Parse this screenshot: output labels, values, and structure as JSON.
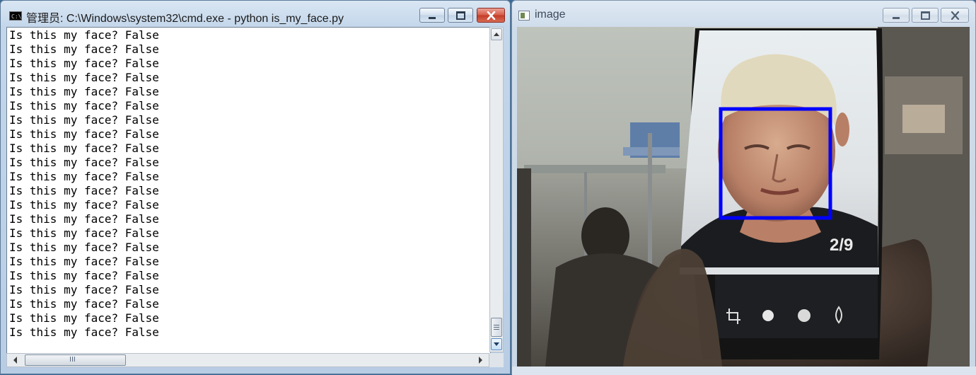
{
  "cmd_window": {
    "title": "管理员: C:\\Windows\\system32\\cmd.exe - python  is_my_face.py",
    "icon": "console-icon",
    "lines": [
      "Is this my face? False",
      "Is this my face? False",
      "Is this my face? False",
      "Is this my face? False",
      "Is this my face? False",
      "Is this my face? False",
      "Is this my face? False",
      "Is this my face? False",
      "Is this my face? False",
      "Is this my face? False",
      "Is this my face? False",
      "Is this my face? False",
      "Is this my face? False",
      "Is this my face? False",
      "Is this my face? False",
      "Is this my face? False",
      "Is this my face? False",
      "Is this my face? False",
      "Is this my face? False",
      "Is this my face? False",
      "Is this my face? False",
      "Is this my face? False"
    ],
    "hscroll_glyph": "III"
  },
  "image_window": {
    "title": "image",
    "icon": "image-icon",
    "phone_counter": "2/9",
    "face_box_color": "#0000ff"
  },
  "colors": {
    "close_red": "#c23b27",
    "face_box": "#0000ff"
  }
}
